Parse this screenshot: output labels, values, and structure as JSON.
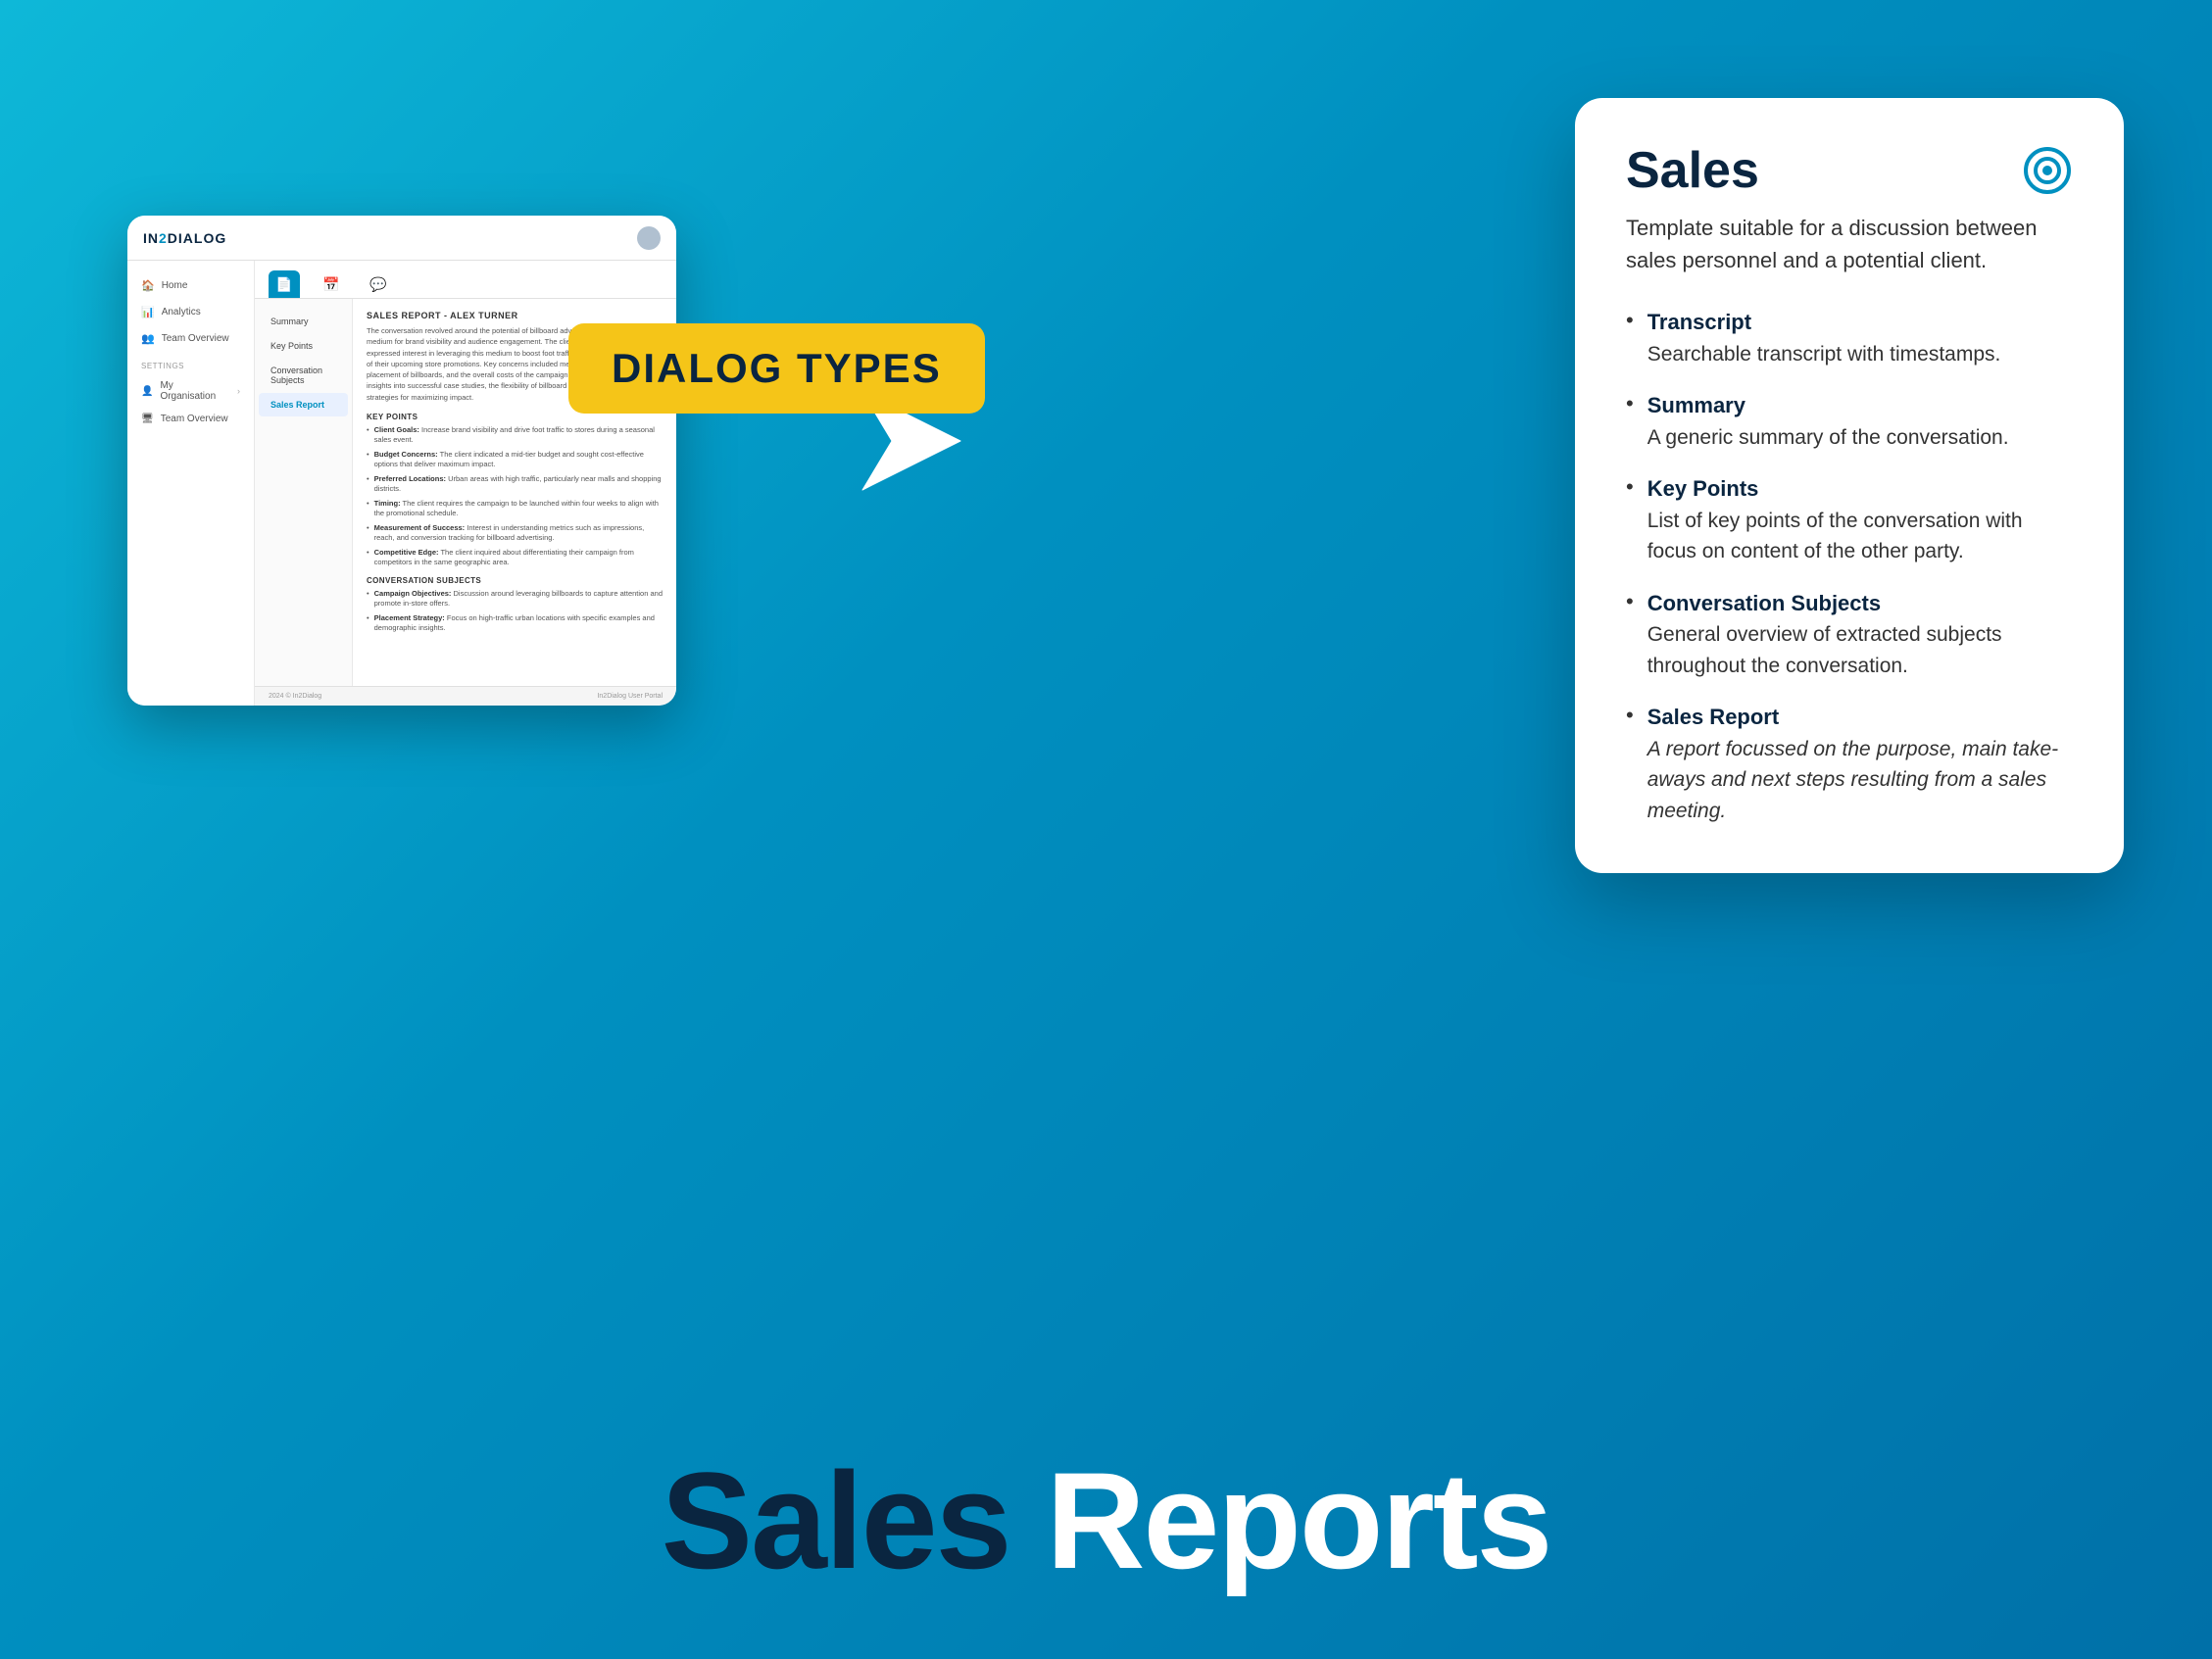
{
  "background": {
    "gradient_start": "#0eb8d8",
    "gradient_end": "#0070a8"
  },
  "dialog_badge": {
    "label": "DIALOG TYPES"
  },
  "app_card": {
    "logo": "IN2DIALOG",
    "nav": {
      "items": [
        {
          "label": "Home",
          "icon": "🏠"
        },
        {
          "label": "Analytics",
          "icon": "📊"
        },
        {
          "label": "Team Overview",
          "icon": "👥"
        }
      ],
      "settings_label": "SETTINGS",
      "settings_items": [
        {
          "label": "My Organisation",
          "icon": "👤"
        },
        {
          "label": "Team Overview",
          "icon": "🖥"
        }
      ]
    },
    "tabs": [
      {
        "icon": "📄",
        "active": true
      },
      {
        "icon": "📅",
        "active": false
      },
      {
        "icon": "💬",
        "active": false
      }
    ],
    "content_nav": [
      {
        "label": "Summary",
        "active": false
      },
      {
        "label": "Key Points",
        "active": false
      },
      {
        "label": "Conversation Subjects",
        "active": false
      },
      {
        "label": "Sales Report",
        "active": true
      }
    ],
    "report": {
      "title": "SALES REPORT - ALEX TURNER",
      "intro": "The conversation revolved around the potential of billboard advertising as a highly effective medium for brand visibility and audience engagement. The client, a regional retail chain, expressed interest in leveraging this medium to boost foot traffic and increase awareness of their upcoming store promotions. Key concerns included measurable ROI, strategic placement of billboards, and the overall costs of the campaign. The salesperson provided insights into successful case studies, the flexibility of billboard campaigns, and data-driven strategies for maximizing impact.",
      "key_points_heading": "KEY POINTS",
      "key_points": [
        {
          "bold": "Client Goals:",
          "text": "Increase brand visibility and drive foot traffic to stores during a seasonal sales event."
        },
        {
          "bold": "Budget Concerns:",
          "text": "The client indicated a mid-tier budget and sought cost-effective options that deliver maximum impact."
        },
        {
          "bold": "Preferred Locations:",
          "text": "Urban areas with high traffic, particularly near malls and shopping districts."
        },
        {
          "bold": "Timing:",
          "text": "The client requires the campaign to be launched within four weeks to align with the promotional schedule."
        },
        {
          "bold": "Measurement of Success:",
          "text": "Interest in understanding metrics such as impressions, reach, and conversion tracking for billboard advertising."
        },
        {
          "bold": "Competitive Edge:",
          "text": "The client inquired about differentiating their campaign from competitors in the same geographic area."
        }
      ],
      "conversation_subjects_heading": "CONVERSATION SUBJECTS",
      "conversation_subjects": [
        {
          "bold": "Campaign Objectives:",
          "text": "Discussion around leveraging billboards to capture attention and promote in-store offers."
        },
        {
          "bold": "Placement Strategy:",
          "text": "Focus on high-traffic urban locations with specific examples and demographic insights."
        }
      ]
    },
    "footer": {
      "left": "2024 © In2Dialog",
      "right": "In2Dialog User Portal"
    }
  },
  "info_card": {
    "title": "Sales",
    "description": "Template suitable for a discussion between sales personnel and a potential client.",
    "features": [
      {
        "name": "Transcript",
        "description": "Searchable transcript with timestamps."
      },
      {
        "name": "Summary",
        "description": "A generic summary of the conversation."
      },
      {
        "name": "Key Points",
        "description": "List of key points of the conversation with focus on content of the other party."
      },
      {
        "name": "Conversation Subjects",
        "description": "General overview of extracted subjects throughout the conversation."
      },
      {
        "name": "Sales Report",
        "description_italic": "A report focussed on the purpose, main take-aways and next steps resulting from a sales meeting."
      }
    ]
  },
  "bottom_title": {
    "dark_part": "Sales",
    "light_part": "Reports"
  }
}
